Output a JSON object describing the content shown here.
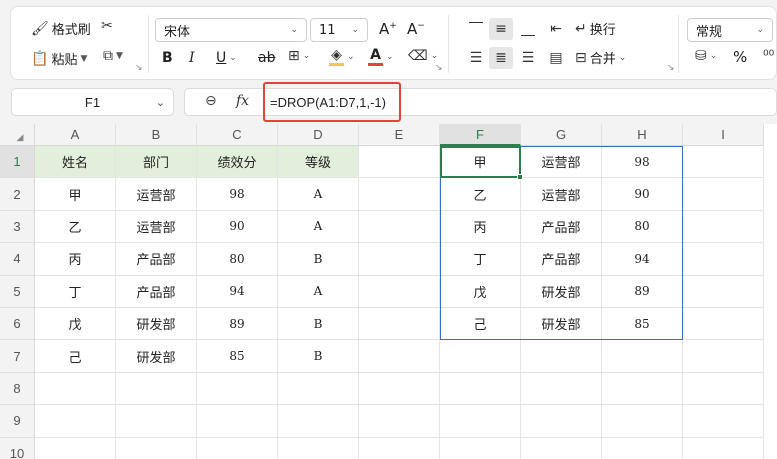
{
  "ribbon": {
    "format_painter": "格式刷",
    "paste": "粘贴",
    "font_name": "宋体",
    "font_size": "11",
    "wrap_text": "换行",
    "merge": "合并",
    "number_format": "常规",
    "percent": "%"
  },
  "formula_bar": {
    "name_box": "F1",
    "fx": "fx",
    "formula": "=DROP(A1:D7,1,-1)"
  },
  "columns": [
    "A",
    "B",
    "C",
    "D",
    "E",
    "F",
    "G",
    "H",
    "I"
  ],
  "rows": [
    "1",
    "2",
    "3",
    "4",
    "5",
    "6",
    "7",
    "8",
    "9",
    "10"
  ],
  "source_table": {
    "headers": [
      "姓名",
      "部门",
      "绩效分",
      "等级"
    ],
    "rows": [
      [
        "甲",
        "运营部",
        "98",
        "A"
      ],
      [
        "乙",
        "运营部",
        "90",
        "A"
      ],
      [
        "丙",
        "产品部",
        "80",
        "B"
      ],
      [
        "丁",
        "产品部",
        "94",
        "A"
      ],
      [
        "戊",
        "研发部",
        "89",
        "B"
      ],
      [
        "己",
        "研发部",
        "85",
        "B"
      ]
    ]
  },
  "result_table": {
    "rows": [
      [
        "甲",
        "运营部",
        "98"
      ],
      [
        "乙",
        "运营部",
        "90"
      ],
      [
        "丙",
        "产品部",
        "80"
      ],
      [
        "丁",
        "产品部",
        "94"
      ],
      [
        "戊",
        "研发部",
        "89"
      ],
      [
        "己",
        "研发部",
        "85"
      ]
    ]
  },
  "colors": {
    "header_fill": "#e2efda",
    "selection": "#2e7d4f",
    "spill_border": "#3b6fc4",
    "highlight_box": "#e0443a",
    "font_color_bar": "#e0443a",
    "fill_color_bar": "#f2c84b"
  }
}
